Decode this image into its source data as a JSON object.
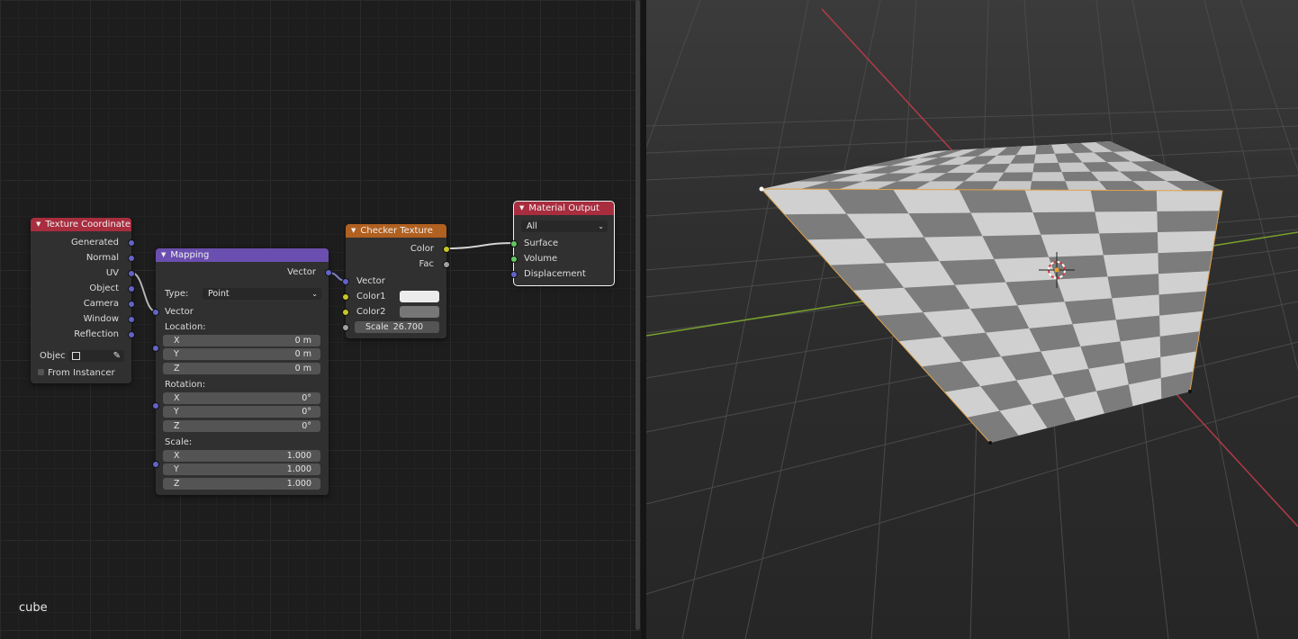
{
  "object_name": "cube",
  "nodes": {
    "texture_coordinate": {
      "title": "Texture Coordinate",
      "header_color": "#a82d3e",
      "outputs": [
        "Generated",
        "Normal",
        "UV",
        "Object",
        "Camera",
        "Window",
        "Reflection"
      ],
      "object_label": "Objec",
      "from_instancer": "From Instancer"
    },
    "mapping": {
      "title": "Mapping",
      "header_color": "#6b4fb0",
      "output": "Vector",
      "type_label": "Type:",
      "type_value": "Point",
      "input_vector": "Vector",
      "location_label": "Location:",
      "location": [
        {
          "axis": "X",
          "value": "0 m"
        },
        {
          "axis": "Y",
          "value": "0 m"
        },
        {
          "axis": "Z",
          "value": "0 m"
        }
      ],
      "rotation_label": "Rotation:",
      "rotation": [
        {
          "axis": "X",
          "value": "0°"
        },
        {
          "axis": "Y",
          "value": "0°"
        },
        {
          "axis": "Z",
          "value": "0°"
        }
      ],
      "scale_label": "Scale:",
      "scale": [
        {
          "axis": "X",
          "value": "1.000"
        },
        {
          "axis": "Y",
          "value": "1.000"
        },
        {
          "axis": "Z",
          "value": "1.000"
        }
      ]
    },
    "checker_texture": {
      "title": "Checker Texture",
      "header_color": "#b0601f",
      "outputs": [
        "Color",
        "Fac"
      ],
      "input_vector": "Vector",
      "color1_label": "Color1",
      "color1": "#ececec",
      "color2_label": "Color2",
      "color2": "#777777",
      "scale_label": "Scale",
      "scale_value": "26.700"
    },
    "material_output": {
      "title": "Material Output",
      "header_color": "#a82d3e",
      "target": "All",
      "inputs": [
        "Surface",
        "Volume",
        "Displacement"
      ]
    }
  },
  "colors": {
    "vector_socket": "#6363c7",
    "color_socket": "#c7c729",
    "float_socket": "#a1a1a1",
    "shader_socket": "#63c763",
    "checker_light": "#d0d0d0",
    "checker_dark": "#7c7c7c",
    "axis_x": "#b23a48",
    "axis_y": "#7aa02c"
  }
}
